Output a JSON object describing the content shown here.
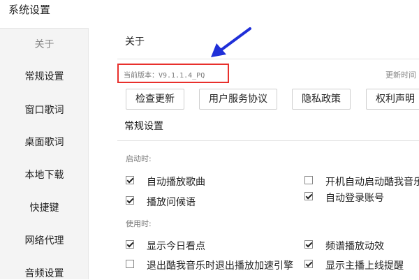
{
  "window": {
    "title": "系统设置"
  },
  "sidebar": {
    "items": [
      {
        "label": "关于",
        "active": true
      },
      {
        "label": "常规设置",
        "active": false
      },
      {
        "label": "窗口歌词",
        "active": false
      },
      {
        "label": "桌面歌词",
        "active": false
      },
      {
        "label": "本地下载",
        "active": false
      },
      {
        "label": "快捷键",
        "active": false
      },
      {
        "label": "网络代理",
        "active": false
      },
      {
        "label": "音频设置",
        "active": false
      }
    ]
  },
  "about": {
    "title": "关于",
    "version_text": "当前版本：V9.1.1.4_PQ",
    "update_time_label": "更新时间",
    "buttons": [
      "检查更新",
      "用户服务协议",
      "隐私政策",
      "权利声明"
    ]
  },
  "general": {
    "title": "常规设置",
    "startup_label": "启动时:",
    "usage_label": "使用时:",
    "startup_options": [
      {
        "label": "自动播放歌曲",
        "checked": true
      },
      {
        "label": "开机自动启动酷我音乐",
        "checked": false
      },
      {
        "label": "播放问候语",
        "checked": true
      },
      {
        "label": "自动登录账号",
        "checked": true
      }
    ],
    "usage_options": [
      {
        "label": "显示今日看点",
        "checked": true
      },
      {
        "label": "频谱播放动效",
        "checked": true
      },
      {
        "label": "退出酷我音乐时退出播放加速引擎",
        "checked": false
      },
      {
        "label": "显示主播上线提醒",
        "checked": true
      }
    ]
  },
  "colors": {
    "highlight_box": "#e8302c",
    "annotation_arrow": "#1f2fd8",
    "sidebar_bg": "#f4f4f4"
  },
  "icons": {
    "annotation": "arrow-pointer-icon",
    "checkbox_checked": "checkmark-icon"
  }
}
